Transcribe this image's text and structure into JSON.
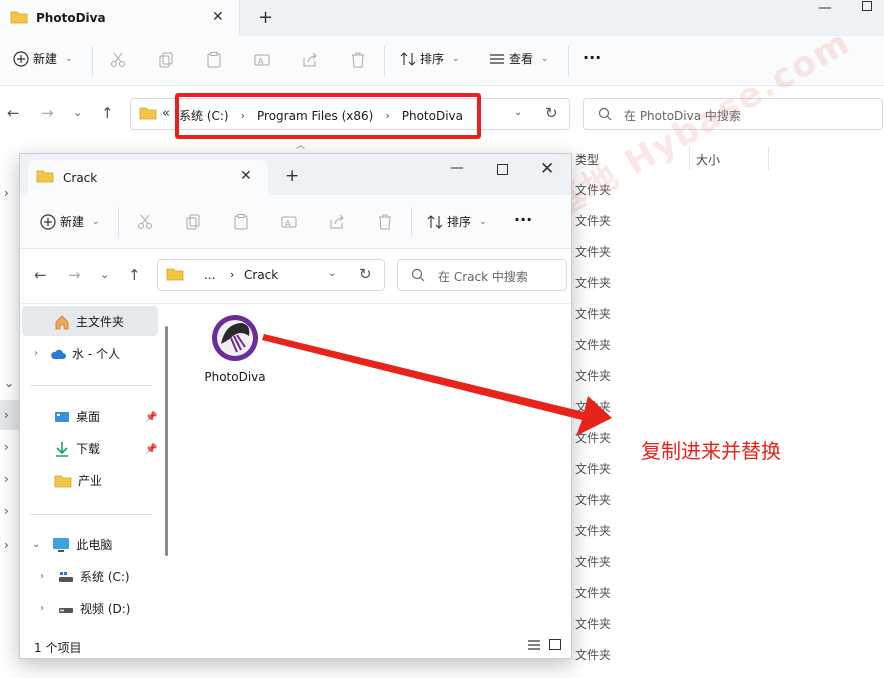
{
  "bg": {
    "tab_title": "PhotoDiva",
    "close_glyph": "✕",
    "newtab_glyph": "+",
    "min_glyph": "—",
    "toolbar": {
      "new_label": "新建",
      "sort_label": "排序",
      "view_label": "查看",
      "more_label": "···"
    },
    "address": {
      "lq": "«",
      "crumbs": [
        "系统 (C:)",
        "Program Files (x86)",
        "PhotoDiva"
      ]
    },
    "search_placeholder": "在 PhotoDiva 中搜索",
    "columns": {
      "type": "类型",
      "size": "大小"
    },
    "type_values": [
      "文件夹",
      "文件夹",
      "文件夹",
      "文件夹",
      "文件夹",
      "文件夹",
      "文件夹",
      "文件夹",
      "文件夹",
      "文件夹",
      "文件夹",
      "文件夹",
      "文件夹",
      "文件夹",
      "文件夹",
      "文件夹"
    ]
  },
  "fg": {
    "tab_title": "Crack",
    "toolbar": {
      "new_label": "新建",
      "sort_label": "排序",
      "more_label": "···"
    },
    "address": {
      "dots": "...",
      "crumb": "Crack"
    },
    "search_placeholder": "在 Crack 中搜索",
    "sidebar": {
      "home": "主文件夹",
      "onedrive": "水 - 个人",
      "desktop": "桌面",
      "downloads": "下载",
      "industry": "产业",
      "thispc": "此电脑",
      "drive_c": "系统 (C:)",
      "drive_d": "视频 (D:)"
    },
    "file": {
      "name": "PhotoDiva"
    },
    "status": "1 个项目"
  },
  "annotation": "复制进来并替换",
  "watermark": "记得收藏·黑域基地  Hybase.com",
  "colors": {
    "accent_red": "#e8231b",
    "folder_yellow": "#f4c542"
  }
}
